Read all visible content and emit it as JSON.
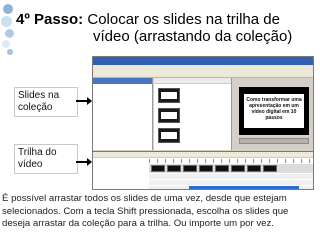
{
  "slide": {
    "title_step": "4º Passo:",
    "title_line1": " Colocar os slides na trilha de",
    "title_line2": "vídeo (arrastando da coleção)",
    "label_slides": "Slides na coleção",
    "label_trilha": "Trilha do vídeo",
    "description": "É possível arrastar todos os slides de uma vez, desde que estejam selecionados. Com a tecla Shift pressionada, escolha os slides que deseja arrastar da coleção para a trilha. Ou importe um por vez."
  },
  "colors": {
    "title_bar": "#2f5fb5",
    "task_header": "#2b52a8",
    "timeline_highlight": "#2a6dd6"
  },
  "screenshot": {
    "preview_text": "Como transformar uma apresentação em um vídeo digital em 10 passos",
    "collection_items": [
      {
        "icon": "slide-thumbnail-icon"
      },
      {
        "icon": "slide-thumbnail-icon"
      },
      {
        "icon": "slide-thumbnail-icon"
      }
    ],
    "timeline_clips": 8
  }
}
